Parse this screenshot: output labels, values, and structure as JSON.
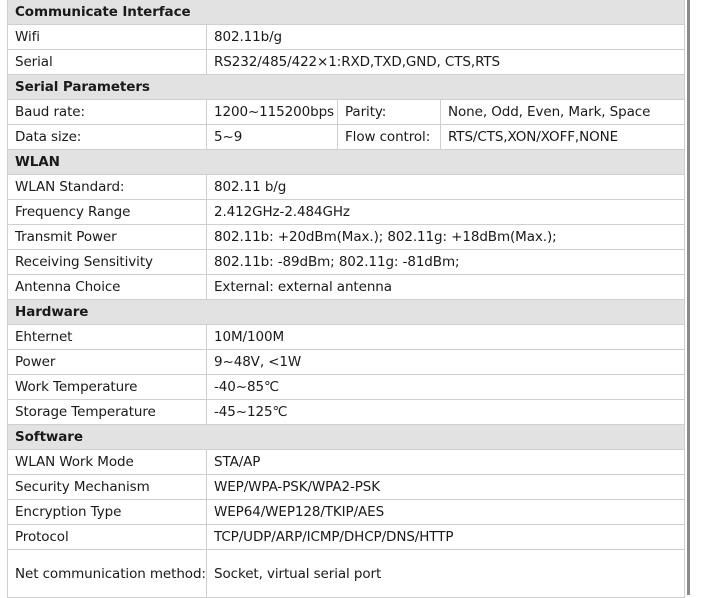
{
  "sections": {
    "communicate": "Communicate Interface",
    "serial_params": "Serial Parameters",
    "wlan": "WLAN",
    "hardware": "Hardware",
    "software": "Software"
  },
  "rows": {
    "wifi": {
      "label": "Wifi",
      "value": "802.11b/g"
    },
    "serial": {
      "label": "Serial",
      "value": "RS232/485/422×1:RXD,TXD,GND, CTS,RTS"
    },
    "baud": {
      "label": "Baud rate:",
      "value": "1200~115200bps",
      "label2": "Parity:",
      "value2": "None, Odd, Even, Mark, Space"
    },
    "datasize": {
      "label": "Data size:",
      "value": "5~9",
      "label2": "Flow control:",
      "value2": "RTS/CTS,XON/XOFF,NONE"
    },
    "wlan_std": {
      "label": "WLAN Standard:",
      "value": "802.11 b/g"
    },
    "freq": {
      "label": "Frequency Range",
      "value": "2.412GHz-2.484GHz"
    },
    "tx_power": {
      "label": "Transmit Power",
      "value": "802.11b: +20dBm(Max.); 802.11g: +18dBm(Max.);"
    },
    "rx_sens": {
      "label": "Receiving Sensitivity",
      "value": "802.11b: -89dBm; 802.11g: -81dBm;"
    },
    "antenna": {
      "label": "Antenna Choice",
      "value": "External: external antenna"
    },
    "ethernet": {
      "label": "Ehternet",
      "value": "10M/100M"
    },
    "power": {
      "label": "Power",
      "value": "9~48V, <1W"
    },
    "work_temp": {
      "label": "Work Temperature",
      "value": "-40~85℃"
    },
    "storage_temp": {
      "label": "Storage Temperature",
      "value": "-45~125℃"
    },
    "wlan_mode": {
      "label": "WLAN Work Mode",
      "value": "STA/AP"
    },
    "security": {
      "label": "Security Mechanism",
      "value": "WEP/WPA-PSK/WPA2-PSK"
    },
    "encryption": {
      "label": "Encryption Type",
      "value": "WEP64/WEP128/TKIP/AES"
    },
    "protocol": {
      "label": "Protocol",
      "value": "TCP/UDP/ARP/ICMP/DHCP/DNS/HTTP"
    },
    "net_method": {
      "label": "Net communication method:",
      "value": "Socket, virtual serial port"
    }
  }
}
